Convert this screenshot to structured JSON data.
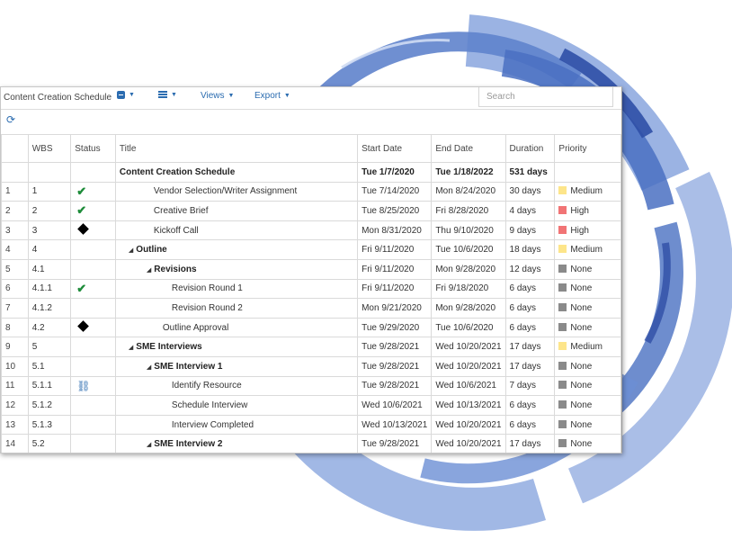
{
  "colors": {
    "accent": "#2b6cb0",
    "ring_light": "#9bb3e3",
    "ring_mid": "#6b8fd4",
    "ring_dark": "#3a5fb8",
    "medium": "#fde58a",
    "high": "#f17475",
    "none": "#8a8a8a",
    "check": "#1e8c3a"
  },
  "toolbar": {
    "title": "Content Creation Schedule",
    "views_label": "Views",
    "export_label": "Export",
    "search_placeholder": "Search",
    "icons": [
      "collapse-icon",
      "list-icon",
      "refresh-icon"
    ]
  },
  "columns": [
    "WBS",
    "Status",
    "Title",
    "Start Date",
    "End Date",
    "Duration",
    "Priority"
  ],
  "summary": {
    "title": "Content Creation Schedule",
    "start": "Tue 1/7/2020",
    "end": "Tue 1/18/2022",
    "duration": "531 days"
  },
  "rows": [
    {
      "num": "1",
      "wbs": "1",
      "status": "check",
      "title": "Vendor Selection/Writer Assignment",
      "bold": false,
      "expander": false,
      "indent": 1,
      "start": "Tue 7/14/2020",
      "end": "Mon 8/24/2020",
      "duration": "30 days",
      "priority": "Medium"
    },
    {
      "num": "2",
      "wbs": "2",
      "status": "check",
      "title": "Creative Brief",
      "bold": false,
      "expander": false,
      "indent": 1,
      "start": "Tue 8/25/2020",
      "end": "Fri 8/28/2020",
      "duration": "4 days",
      "priority": "High"
    },
    {
      "num": "3",
      "wbs": "3",
      "status": "diamond",
      "title": "Kickoff Call",
      "bold": false,
      "expander": false,
      "indent": 1,
      "start": "Mon 8/31/2020",
      "end": "Thu 9/10/2020",
      "duration": "9 days",
      "priority": "High"
    },
    {
      "num": "4",
      "wbs": "4",
      "status": "",
      "title": "Outline",
      "bold": true,
      "expander": true,
      "indent": 0,
      "start": "Fri 9/11/2020",
      "end": "Tue 10/6/2020",
      "duration": "18 days",
      "priority": "Medium"
    },
    {
      "num": "5",
      "wbs": "4.1",
      "status": "",
      "title": "Revisions",
      "bold": true,
      "expander": true,
      "indent": 1,
      "start": "Fri 9/11/2020",
      "end": "Mon 9/28/2020",
      "duration": "12 days",
      "priority": "None"
    },
    {
      "num": "6",
      "wbs": "4.1.1",
      "status": "check",
      "title": "Revision Round 1",
      "bold": false,
      "expander": false,
      "indent": 2,
      "start": "Fri 9/11/2020",
      "end": "Fri 9/18/2020",
      "duration": "6 days",
      "priority": "None"
    },
    {
      "num": "7",
      "wbs": "4.1.2",
      "status": "",
      "title": "Revision Round 2",
      "bold": false,
      "expander": false,
      "indent": 2,
      "start": "Mon 9/21/2020",
      "end": "Mon 9/28/2020",
      "duration": "6 days",
      "priority": "None"
    },
    {
      "num": "8",
      "wbs": "4.2",
      "status": "diamond",
      "title": "Outline Approval",
      "bold": false,
      "expander": false,
      "indent": 1.5,
      "start": "Tue 9/29/2020",
      "end": "Tue 10/6/2020",
      "duration": "6 days",
      "priority": "None"
    },
    {
      "num": "9",
      "wbs": "5",
      "status": "",
      "title": "SME Interviews",
      "bold": true,
      "expander": true,
      "indent": 0,
      "start": "Tue 9/28/2021",
      "end": "Wed 10/20/2021",
      "duration": "17 days",
      "priority": "Medium"
    },
    {
      "num": "10",
      "wbs": "5.1",
      "status": "",
      "title": "SME Interview 1",
      "bold": true,
      "expander": true,
      "indent": 1,
      "start": "Tue 9/28/2021",
      "end": "Wed 10/20/2021",
      "duration": "17 days",
      "priority": "None"
    },
    {
      "num": "11",
      "wbs": "5.1.1",
      "status": "link",
      "title": "Identify Resource",
      "bold": false,
      "expander": false,
      "indent": 2,
      "start": "Tue 9/28/2021",
      "end": "Wed 10/6/2021",
      "duration": "7 days",
      "priority": "None"
    },
    {
      "num": "12",
      "wbs": "5.1.2",
      "status": "",
      "title": "Schedule Interview",
      "bold": false,
      "expander": false,
      "indent": 2,
      "start": "Wed 10/6/2021",
      "end": "Wed 10/13/2021",
      "duration": "6 days",
      "priority": "None"
    },
    {
      "num": "13",
      "wbs": "5.1.3",
      "status": "",
      "title": "Interview Completed",
      "bold": false,
      "expander": false,
      "indent": 2,
      "start": "Wed 10/13/2021",
      "end": "Wed 10/20/2021",
      "duration": "6 days",
      "priority": "None"
    },
    {
      "num": "14",
      "wbs": "5.2",
      "status": "",
      "title": "SME Interview 2",
      "bold": true,
      "expander": true,
      "indent": 1,
      "start": "Tue 9/28/2021",
      "end": "Wed 10/20/2021",
      "duration": "17 days",
      "priority": "None"
    }
  ]
}
